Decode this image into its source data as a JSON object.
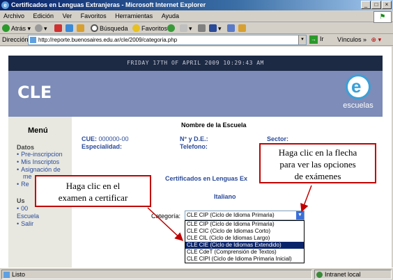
{
  "window": {
    "title": "Certificados en Lenguas Extranjeras - Microsoft Internet Explorer",
    "min": "_",
    "max": "□",
    "close": "×"
  },
  "menu": [
    "Archivo",
    "Edición",
    "Ver",
    "Favoritos",
    "Herramientas",
    "Ayuda"
  ],
  "toolbar": {
    "back": "Atrás",
    "search": "Búsqueda",
    "favorites": "Favoritos"
  },
  "address": {
    "label": "Dirección",
    "url": "http://reporte.buenosaires.edu.ar/cle/2009/categoria.php",
    "go": "Ir",
    "links": "Vínculos"
  },
  "page": {
    "datetime": "FRIDAY 17TH OF APRIL 2009 10:29:43 AM",
    "brand": "CLE",
    "logo_letter": "e",
    "logo_text": "escuelas",
    "sidebar": {
      "title": "Menú",
      "section1": "Datos",
      "items1": [
        "Pre-inscripcion",
        "Mis Inscriptos",
        "Asignación de",
        "me",
        "Re"
      ],
      "section2": "Us",
      "items2": [
        "00",
        "Escuela",
        "Salir"
      ]
    },
    "school_title": "Nombre de la Escuela",
    "cue_label": "CUE:",
    "cue_value": "000000-00",
    "nde_label": "N° y D.E.:",
    "sector_label": "Sector:",
    "especialidad_label": "Especialidad:",
    "telefono_label": "Telefono:",
    "cert_title": "Certificados en Lenguas Ex",
    "language": "Italiano",
    "categoria_label": "Categoría:",
    "categoria_selected": "CLE CIP (Ciclo de Idioma Primaria)",
    "options": [
      "CLE CIP (Ciclo de Idioma Primaria)",
      "CLE CIC (Ciclo de Idiomas Corto)",
      "CLE CIL (Ciclo de Idiomas Largo)",
      "CLE CIE (Ciclo de Idiomas Extendido)",
      "CLE CdeT (Comprensión de Textos)",
      "CLE CIPI (Ciclo de Idioma Primaria Inicial)"
    ],
    "selected_option_index": 3
  },
  "callouts": {
    "right": [
      "Haga clic en la flecha",
      "para ver las opciones",
      "de exámenes"
    ],
    "left": [
      "Haga clic en el",
      "examen a certificar"
    ]
  },
  "status": {
    "text": "Listo",
    "zone": "Intranet local"
  },
  "colors": {
    "callout_border": "#c00000",
    "link": "#2a4a9a",
    "banner": "#7d8cb8"
  }
}
